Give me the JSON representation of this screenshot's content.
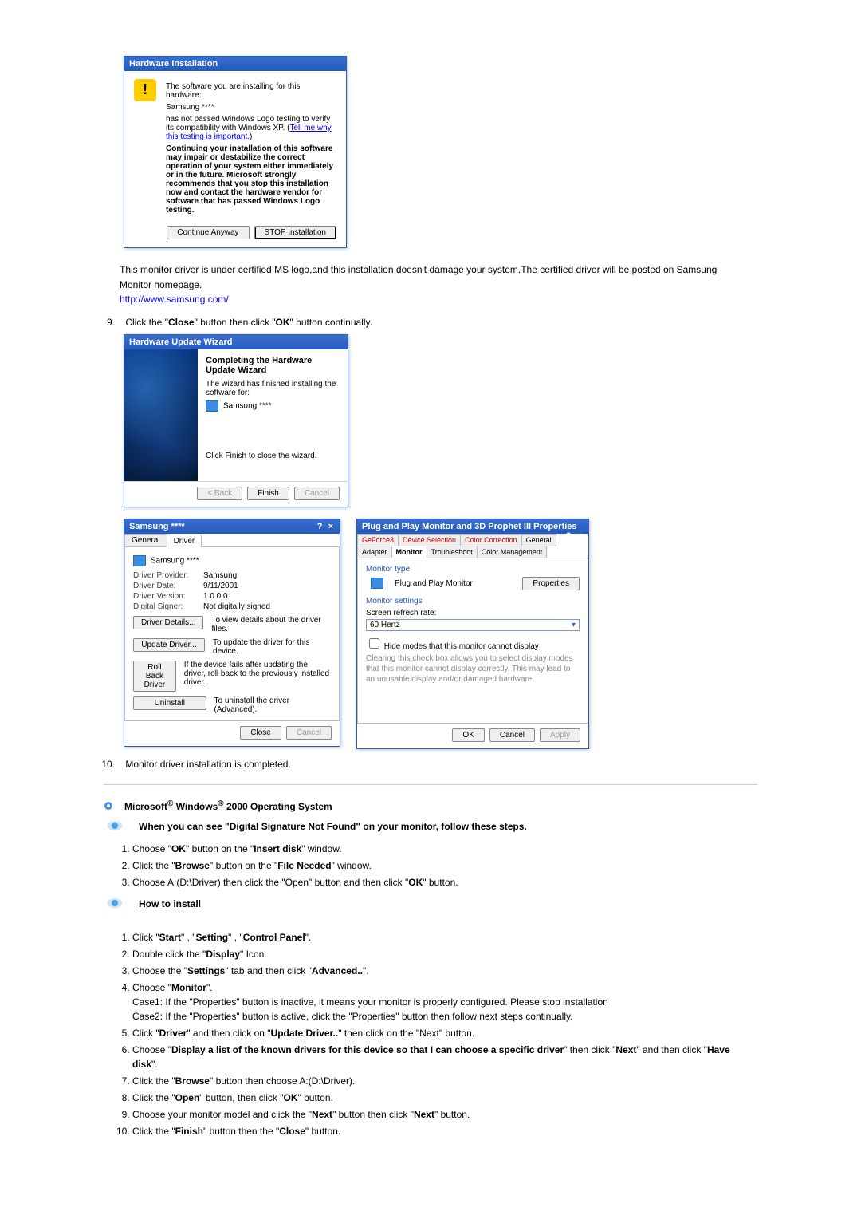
{
  "hw_install": {
    "title": "Hardware Installation",
    "line1": "The software you are installing for this hardware:",
    "device": "Samsung ****",
    "line2a": "has not passed Windows Logo testing to verify its compatibility with Windows XP. (",
    "link": "Tell me why this testing is important.",
    "line2b": ")",
    "bold": "Continuing your installation of this software may impair or destabilize the correct operation of your system either immediately or in the future. Microsoft strongly recommends that you stop this installation now and contact the hardware vendor for software that has passed Windows Logo testing.",
    "btn_continue": "Continue Anyway",
    "btn_stop": "STOP Installation"
  },
  "note": {
    "text": "This monitor driver is under certified MS logo,and this installation doesn't damage your system.The certified driver will be posted on Samsung Monitor homepage.",
    "url": "http://www.samsung.com/"
  },
  "step9": {
    "num": "9.",
    "text_a": "Click the \"",
    "b1": "Close",
    "mid": "\" button then click \"",
    "b2": "OK",
    "text_b": "\" button continually."
  },
  "wizard": {
    "title": "Hardware Update Wizard",
    "heading": "Completing the Hardware Update Wizard",
    "sub": "The wizard has finished installing the software for:",
    "device": "Samsung ****",
    "finish_hint": "Click Finish to close the wizard.",
    "btn_back": "< Back",
    "btn_finish": "Finish",
    "btn_cancel": "Cancel"
  },
  "driver": {
    "title": "Samsung ****",
    "tab_general": "General",
    "tab_driver": "Driver",
    "device": "Samsung ****",
    "rows": {
      "provider_k": "Driver Provider:",
      "provider_v": "Samsung",
      "date_k": "Driver Date:",
      "date_v": "9/11/2001",
      "version_k": "Driver Version:",
      "version_v": "1.0.0.0",
      "signer_k": "Digital Signer:",
      "signer_v": "Not digitally signed"
    },
    "btns": {
      "details": "Driver Details...",
      "details_d": "To view details about the driver files.",
      "update": "Update Driver...",
      "update_d": "To update the driver for this device.",
      "rollback": "Roll Back Driver",
      "rollback_d": "If the device fails after updating the driver, roll back to the previously installed driver.",
      "uninstall": "Uninstall",
      "uninstall_d": "To uninstall the driver (Advanced)."
    },
    "btn_close": "Close",
    "btn_cancel": "Cancel"
  },
  "props": {
    "title": "Plug and Play Monitor and 3D Prophet III Properties",
    "tabs": {
      "geforce": "GeForce3",
      "device_sel": "Device Selection",
      "color_corr": "Color Correction",
      "general": "General",
      "adapter": "Adapter",
      "monitor": "Monitor",
      "trouble": "Troubleshoot",
      "cm": "Color Management"
    },
    "mt_label": "Monitor type",
    "mt_value": "Plug and Play Monitor",
    "btn_properties": "Properties",
    "ms_label": "Monitor settings",
    "refresh_label": "Screen refresh rate:",
    "refresh_value": "60 Hertz",
    "hide": "Hide modes that this monitor cannot display",
    "note": "Clearing this check box allows you to select display modes that this monitor cannot display correctly. This may lead to an unusable display and/or damaged hardware.",
    "ok": "OK",
    "cancel": "Cancel",
    "apply": "Apply"
  },
  "step10": {
    "num": "10.",
    "text": "Monitor driver installation is completed."
  },
  "w2k": {
    "heading": "Microsoft® Windows® 2000 Operating System",
    "sub1": "When you can see \"Digital Signature Not Found\" on your monitor, follow these steps.",
    "a": [
      "Choose \"<b>OK</b>\" button on the \"<b>Insert disk</b>\" window.",
      "Click the \"<b>Browse</b>\" button on the \"<b>File Needed</b>\" window.",
      "Choose A:(D:\\Driver) then click the \"Open\" button and then click \"<b>OK</b>\" button."
    ],
    "sub2": "How to install",
    "b": [
      "Click \"<b>Start</b>\" , \"<b>Setting</b>\" , \"<b>Control Panel</b>\".",
      "Double click the \"<b>Display</b>\" Icon.",
      "Choose the \"<b>Settings</b>\" tab and then click \"<b>Advanced..</b>\".",
      "Choose \"<b>Monitor</b>\".<br>Case1: If the \"Properties\" button is inactive, it means your monitor is properly configured. Please stop installation<br>Case2: If the \"Properties\" button is active, click the \"Properties\" button then follow next steps continually.",
      "Click \"<b>Driver</b>\" and then click on \"<b>Update Driver..</b>\" then click on the \"Next\" button.",
      "Choose \"<b>Display a list of the known drivers for this device so that I can choose a specific driver</b>\" then click \"<b>Next</b>\" and then click \"<b>Have disk</b>\".",
      "Click the \"<b>Browse</b>\" button then choose A:(D:\\Driver).",
      "Click the \"<b>Open</b>\" button, then click \"<b>OK</b>\" button.",
      "Choose your monitor model and click the \"<b>Next</b>\" button then click \"<b>Next</b>\" button.",
      "Click the \"<b>Finish</b>\" button then the \"<b>Close</b>\" button."
    ]
  }
}
